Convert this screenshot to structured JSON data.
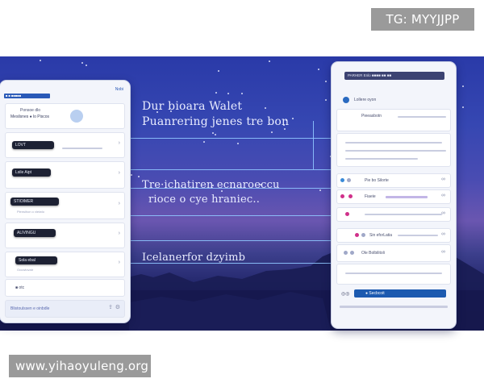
{
  "watermarks": {
    "top": "TG: MYYJJPP",
    "bottom": "www.yihaoyuleng.org"
  },
  "hero": {
    "line1": "Dur bioara Walet",
    "line2": "Puanrering jenes tre bon",
    "line3": "Tre·ichatiren ecnaroeccu",
    "line4": "rioce o cye hraniec..",
    "line5": "Icelanerfor dzyimb"
  },
  "left_panel": {
    "header_tab": "■ ■ ■■■■■",
    "header_right": "Nobi",
    "card_title": "Ponsoe dlo",
    "card_sub": "Mesilsnes ● lo Piscos",
    "pills": [
      "LOVT",
      "Lsile Aipt",
      "STIOIMER",
      "ALIVINGU",
      "Sola ebal"
    ],
    "row_labels": [
      "",
      "",
      "Plensihon o vleiwlo",
      "",
      "Ocuwtovatr"
    ],
    "bottom_label": "■ otc",
    "search_placeholder": "Blistoulssen e oinbdle"
  },
  "right_panel": {
    "header": "PARHER  Enlo  ■■■■ ■■ ■■",
    "top_label": "Lollere oyon",
    "item2": "Pieeasbotn",
    "item3_label": "Pie bo Silorte",
    "item4_label": "Fiaeie",
    "item6_label": "Sin eforLatia",
    "item7_label": "Ole Bolbilitoli",
    "button_label": "● Secbcoit"
  },
  "colors": {
    "accent": "#1c5ab0",
    "sky_top": "#2a3aa8",
    "sky_mid": "#6a56b0"
  }
}
